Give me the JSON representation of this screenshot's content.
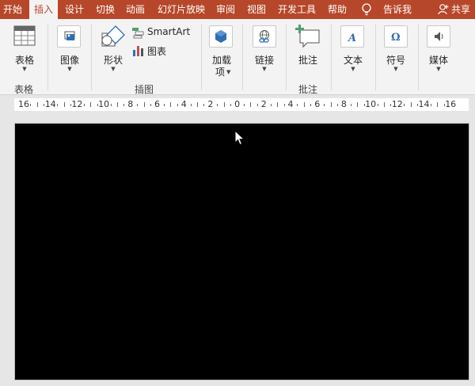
{
  "tabs": [
    {
      "label": "开始",
      "active": false
    },
    {
      "label": "插入",
      "active": true
    },
    {
      "label": "设计",
      "active": false
    },
    {
      "label": "切换",
      "active": false
    },
    {
      "label": "动画",
      "active": false
    },
    {
      "label": "幻灯片放映",
      "active": false
    },
    {
      "label": "审阅",
      "active": false
    },
    {
      "label": "视图",
      "active": false
    },
    {
      "label": "开发工具",
      "active": false
    },
    {
      "label": "帮助",
      "active": false
    }
  ],
  "tell_me": "告诉我",
  "share": "共享",
  "ribbon": {
    "table_btn": "表格",
    "image_btn": "图像",
    "shape_btn": "形状",
    "smartart_btn": "SmartArt",
    "chart_btn": "图表",
    "addin_btn_line1": "加载",
    "addin_btn_line2": "项",
    "link_btn": "链接",
    "comment_btn": "批注",
    "text_btn": "文本",
    "symbol_btn": "符号",
    "media_btn": "媒体",
    "groups": {
      "table": "表格",
      "illustrations": "插图",
      "comments": "批注"
    }
  },
  "ruler": {
    "labels": [
      "16",
      "14",
      "12",
      "10",
      "8",
      "6",
      "4",
      "2",
      "0",
      "2",
      "4",
      "6",
      "8",
      "10",
      "12",
      "14",
      "16"
    ]
  },
  "colors": {
    "accent": "#b7472a",
    "ribbon_bg": "#f3f3f3",
    "slide_bg": "#000000"
  }
}
